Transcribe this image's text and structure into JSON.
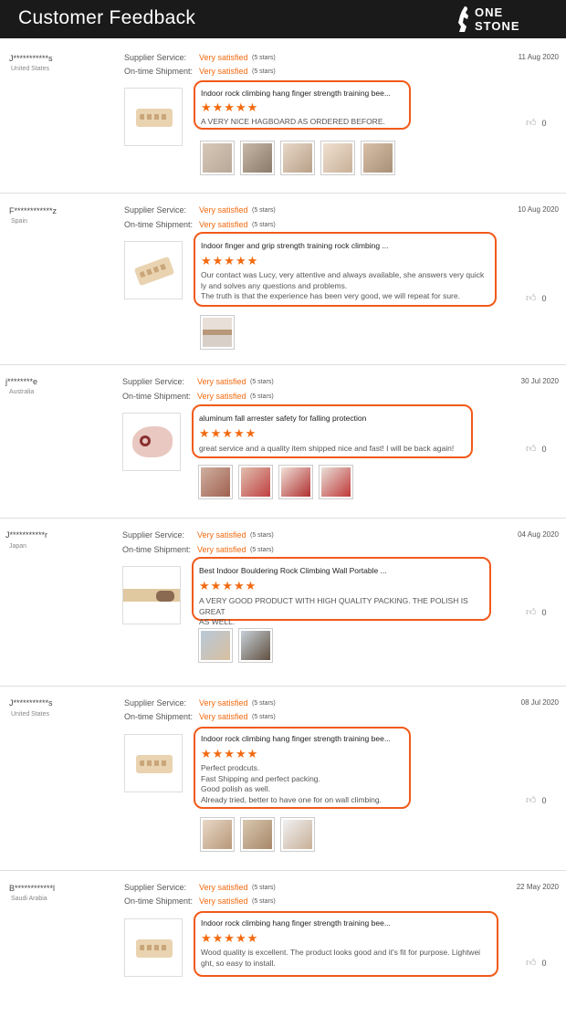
{
  "header": {
    "title": "Customer Feedback",
    "logo_line1": "ONE",
    "logo_line2": "STONE"
  },
  "labels": {
    "supplier_service": "Supplier Service:",
    "shipment": "On-time Shipment:"
  },
  "reviews": [
    {
      "name": "J***********s",
      "country": "United States",
      "date": "11 Aug 2020",
      "supplier_value": "Very satisfied",
      "supplier_stars": "(5 stars)",
      "shipment_value": "Very satisfied",
      "shipment_stars": "(5 stars)",
      "product_title": "Indoor rock climbing hang finger strength training bee...",
      "stars": "★★★★★",
      "comment": [
        "A VERY NICE HAGBOARD AS ORDERED BEFORE."
      ],
      "likes": "0",
      "photo_count": 5
    },
    {
      "name": "F************z",
      "country": "Spain",
      "date": "10 Aug 2020",
      "supplier_value": "Very satisfied",
      "supplier_stars": "(5 stars)",
      "shipment_value": "Very satisfied",
      "shipment_stars": "(5 stars)",
      "product_title": "Indoor finger and grip strength training rock climbing ...",
      "stars": "★★★★★",
      "comment": [
        "Our contact was Lucy, very attentive and always available, she answers very quick",
        "ly and solves any questions and problems.",
        "The truth is that the experience has been very good, we will repeat for sure."
      ],
      "likes": "0",
      "photo_count": 1
    },
    {
      "name": "j********e",
      "country": "Australia",
      "date": "30 Jul 2020",
      "supplier_value": "Very satisfied",
      "supplier_stars": "(5 stars)",
      "shipment_value": "Very satisfied",
      "shipment_stars": "(5 stars)",
      "product_title": "aluminum fall arrester safety for falling protection",
      "stars": "★★★★★",
      "comment": [
        "great service and a quality item shipped nice and fast! I will be back again!"
      ],
      "likes": "0",
      "photo_count": 4
    },
    {
      "name": "J***********r",
      "country": "Japan",
      "date": "04 Aug 2020",
      "supplier_value": "Very satisfied",
      "supplier_stars": "(5 stars)",
      "shipment_value": "Very satisfied",
      "shipment_stars": "(5 stars)",
      "product_title": "Best Indoor Bouldering Rock Climbing Wall Portable ...",
      "stars": "★★★★★",
      "comment": [
        "A VERY GOOD PRODUCT WITH HIGH QUALITY PACKING. THE POLISH IS GREAT",
        "AS WELL."
      ],
      "likes": "0",
      "photo_count": 2
    },
    {
      "name": "J***********s",
      "country": "United States",
      "date": "08 Jul 2020",
      "supplier_value": "Very satisfied",
      "supplier_stars": "(5 stars)",
      "shipment_value": "Very satisfied",
      "shipment_stars": "(5 stars)",
      "product_title": "Indoor rock climbing hang finger strength training bee...",
      "stars": "★★★★★",
      "comment": [
        "Perfect prodcuts.",
        "Fast Shipping and perfect packing.",
        "Good polish as well.",
        "Already tried, better to have one for on wall climbing."
      ],
      "likes": "0",
      "photo_count": 3
    },
    {
      "name": "B************l",
      "country": "Saudi Arabia",
      "date": "22 May 2020",
      "supplier_value": "Very satisfied",
      "supplier_stars": "(5 stars)",
      "shipment_value": "Very satisfied",
      "shipment_stars": "(5 stars)",
      "product_title": "Indoor rock climbing hang finger strength training bee...",
      "stars": "★★★★★",
      "comment": [
        "Wood quality is excellent. The product looks good and it's fit for purpose. Lightwei",
        "ght, so easy to install."
      ],
      "likes": "0",
      "photo_count": 0
    }
  ],
  "icons": {
    "like": "thumbs-up-icon",
    "logo": "climber-logo-icon"
  },
  "colors": {
    "accent": "#f15a1a",
    "header_bg": "#1a1a1a"
  }
}
